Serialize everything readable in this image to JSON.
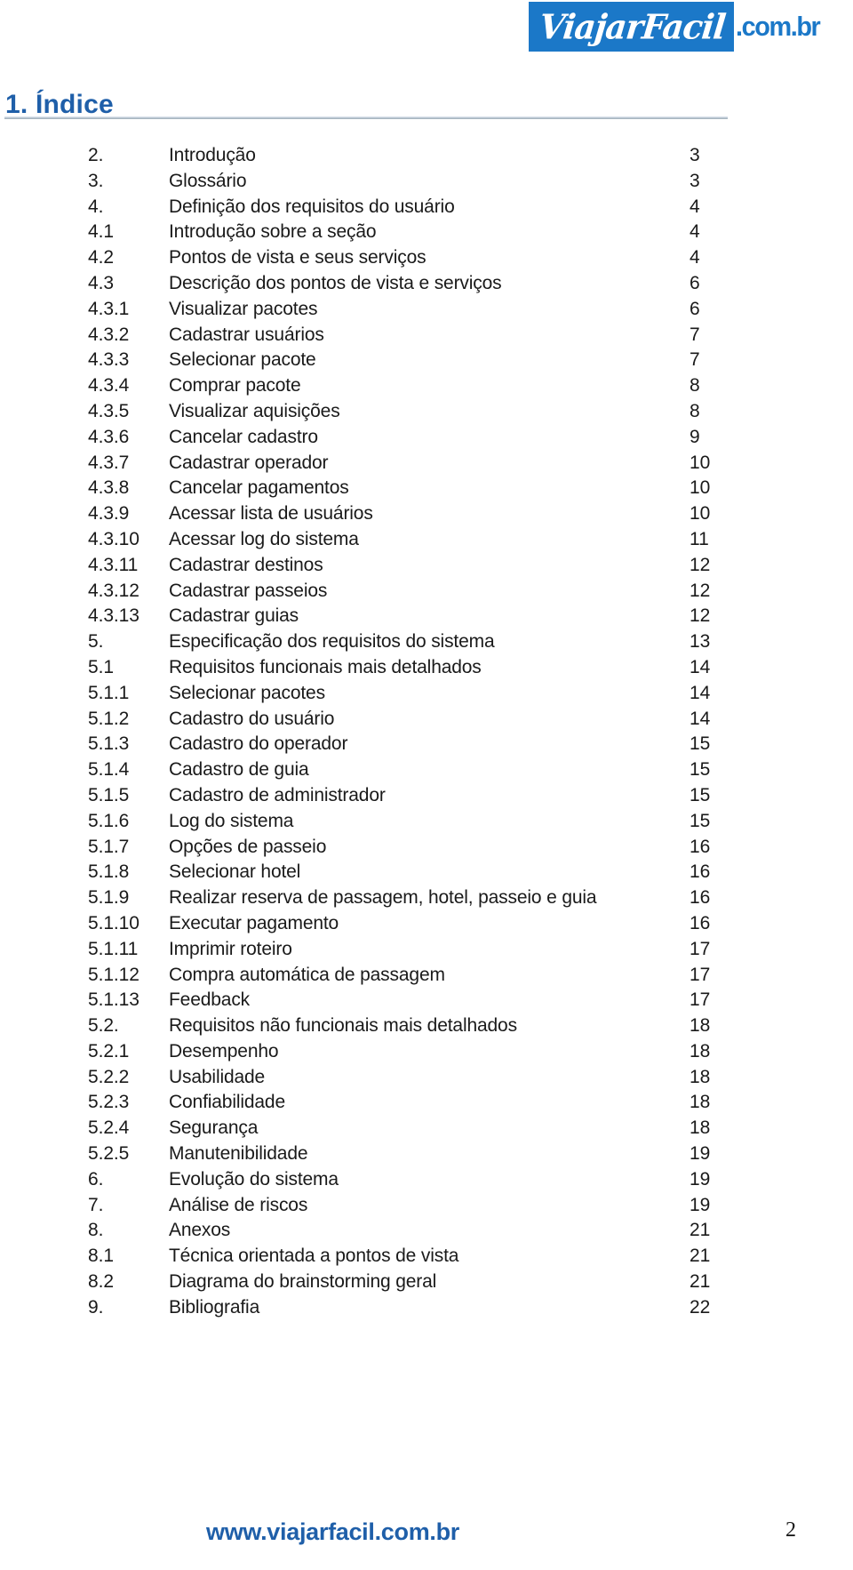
{
  "header": {
    "logo": {
      "brand_word": "ViajarFacil",
      "tld": ".com.br",
      "box_color": "#1b78c8",
      "word_color": "#ffffff"
    }
  },
  "title": {
    "text": "1. Índice",
    "color": "#1f5fa9"
  },
  "toc": {
    "entries": [
      {
        "num": "2.",
        "label": "Introdução",
        "page": "3"
      },
      {
        "num": "3.",
        "label": "Glossário",
        "page": "3"
      },
      {
        "num": "4.",
        "label": "Definição dos requisitos do usuário",
        "page": "4"
      },
      {
        "num": "4.1",
        "label": "Introdução sobre a seção",
        "page": "4"
      },
      {
        "num": "4.2",
        "label": "Pontos de vista e seus serviços",
        "page": "4"
      },
      {
        "num": "4.3",
        "label": "Descrição dos pontos de vista e serviços",
        "page": "6"
      },
      {
        "num": "4.3.1",
        "label": "Visualizar pacotes",
        "page": "6"
      },
      {
        "num": "4.3.2",
        "label": "Cadastrar usuários",
        "page": "7"
      },
      {
        "num": "4.3.3",
        "label": "Selecionar pacote",
        "page": "7"
      },
      {
        "num": "4.3.4",
        "label": "Comprar pacote",
        "page": "8"
      },
      {
        "num": "4.3.5",
        "label": "Visualizar aquisições",
        "page": "8"
      },
      {
        "num": "4.3.6",
        "label": "Cancelar cadastro",
        "page": "9"
      },
      {
        "num": "4.3.7",
        "label": "Cadastrar operador",
        "page": "10"
      },
      {
        "num": "4.3.8",
        "label": "Cancelar pagamentos",
        "page": "10"
      },
      {
        "num": "4.3.9",
        "label": "Acessar lista de usuários",
        "page": "10"
      },
      {
        "num": "4.3.10",
        "label": "Acessar log do sistema",
        "page": "11"
      },
      {
        "num": "4.3.11",
        "label": "Cadastrar destinos",
        "page": "12"
      },
      {
        "num": "4.3.12",
        "label": "Cadastrar passeios",
        "page": "12"
      },
      {
        "num": "4.3.13",
        "label": "Cadastrar guias",
        "page": "12"
      },
      {
        "num": "5.",
        "label": "Especificação dos requisitos do sistema",
        "page": "13"
      },
      {
        "num": "5.1",
        "label": "Requisitos funcionais mais detalhados",
        "page": "14"
      },
      {
        "num": "5.1.1",
        "label": "Selecionar pacotes",
        "page": "14"
      },
      {
        "num": "5.1.2",
        "label": "Cadastro do usuário",
        "page": "14"
      },
      {
        "num": "5.1.3",
        "label": "Cadastro do operador",
        "page": "15"
      },
      {
        "num": "5.1.4",
        "label": "Cadastro de guia",
        "page": "15"
      },
      {
        "num": "5.1.5",
        "label": "Cadastro de administrador",
        "page": "15"
      },
      {
        "num": "5.1.6",
        "label": "Log do sistema",
        "page": "15"
      },
      {
        "num": "5.1.7",
        "label": "Opções de passeio",
        "page": "16"
      },
      {
        "num": "5.1.8",
        "label": "Selecionar hotel",
        "page": "16"
      },
      {
        "num": "5.1.9",
        "label": "Realizar reserva de passagem, hotel, passeio e guia",
        "page": "16"
      },
      {
        "num": "5.1.10",
        "label": "Executar pagamento",
        "page": "16"
      },
      {
        "num": "5.1.11",
        "label": "Imprimir roteiro",
        "page": "17"
      },
      {
        "num": "5.1.12",
        "label": "Compra automática de passagem",
        "page": "17"
      },
      {
        "num": "5.1.13",
        "label": "Feedback",
        "page": "17"
      },
      {
        "num": "5.2.",
        "label": "Requisitos não funcionais mais detalhados",
        "page": "18"
      },
      {
        "num": "5.2.1",
        "label": "Desempenho",
        "page": "18"
      },
      {
        "num": "5.2.2",
        "label": "Usabilidade",
        "page": "18"
      },
      {
        "num": "5.2.3",
        "label": "Confiabilidade",
        "page": "18"
      },
      {
        "num": "5.2.4",
        "label": "Segurança",
        "page": "18"
      },
      {
        "num": "5.2.5",
        "label": "Manutenibilidade",
        "page": "19"
      },
      {
        "num": "6.",
        "label": "Evolução do sistema",
        "page": "19"
      },
      {
        "num": "7.",
        "label": "Análise de riscos",
        "page": "19"
      },
      {
        "num": "8.",
        "label": "Anexos",
        "page": "21"
      },
      {
        "num": "8.1",
        "label": "Técnica orientada a pontos de vista",
        "page": "21"
      },
      {
        "num": "8.2",
        "label": "Diagrama do brainstorming geral",
        "page": "21"
      },
      {
        "num": "9.",
        "label": "Bibliografia",
        "page": "22"
      }
    ]
  },
  "footer": {
    "url": "www.viajarfacil.com.br",
    "url_color": "#1f5fa9",
    "page_number": "2"
  }
}
